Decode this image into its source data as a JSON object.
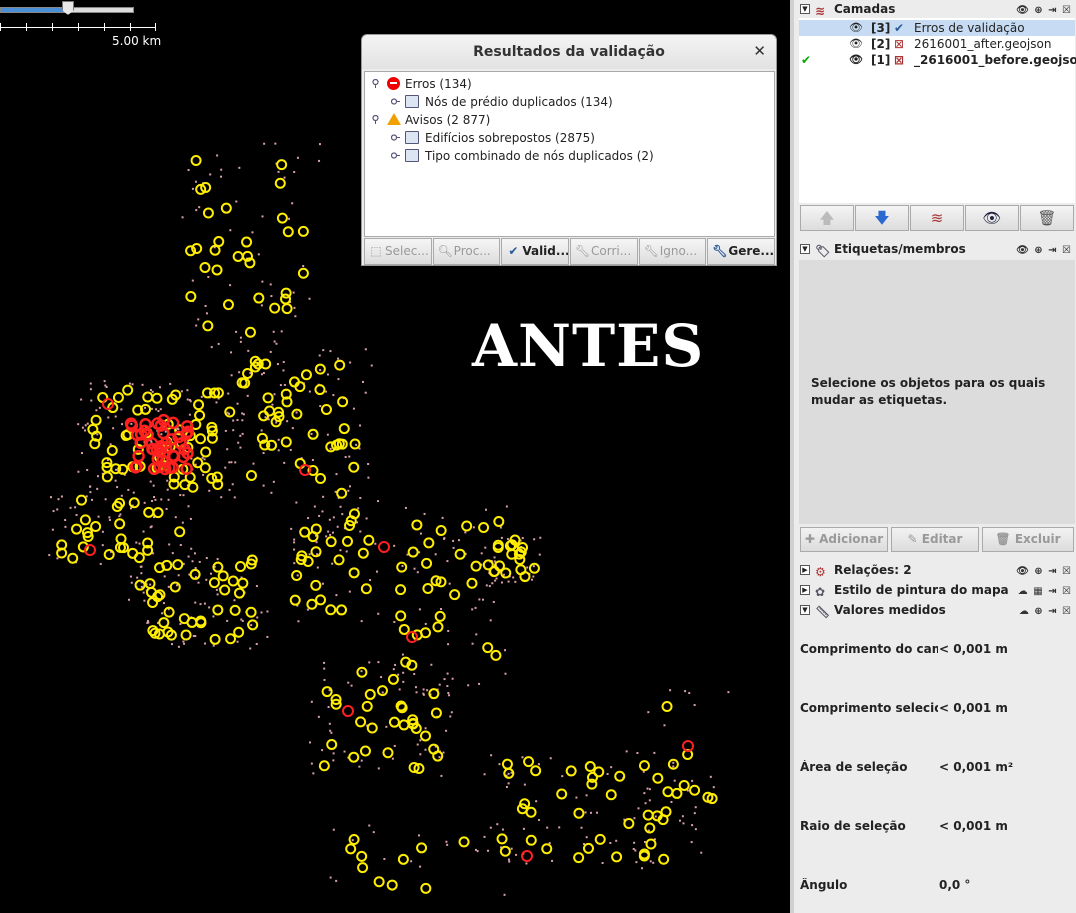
{
  "map": {
    "overlay_text": "ANTES",
    "scale_label": "5.00 km",
    "colors": {
      "background": "#000000",
      "warning_marker": "#ffee00",
      "error_marker": "#ff2020",
      "node": "#d8a0a8"
    }
  },
  "validation_dialog": {
    "title": "Resultados da validação",
    "close_icon": "close-icon",
    "tree": [
      {
        "label": "Erros (134)",
        "icon": "error-icon",
        "level": 0
      },
      {
        "label": "Nós de prédio duplicados (134)",
        "icon": "folder-icon",
        "level": 1
      },
      {
        "label": "Avisos (2 877)",
        "icon": "warning-icon",
        "level": 0
      },
      {
        "label": "Edifícios sobrepostos (2875)",
        "icon": "folder-icon",
        "level": 1
      },
      {
        "label": "Tipo combinado de nós duplicados (2)",
        "icon": "folder-icon",
        "level": 1
      }
    ],
    "buttons": [
      "Selec...",
      "Proc...",
      "Valid...",
      "Corri...",
      "Igno...",
      "Gere..."
    ]
  },
  "panel": {
    "layers": {
      "title": "Camadas",
      "items": [
        {
          "index": "[3]",
          "name": "Erros de validação",
          "selected": true
        },
        {
          "index": "[2]",
          "name": "2616001_after.geojson",
          "selected": false
        },
        {
          "index": "[1]",
          "name": "_2616001_before.geojson",
          "selected": false,
          "active": true
        }
      ]
    },
    "tags": {
      "title": "Etiquetas/membros",
      "message": "Selecione os objetos para os quais mudar as etiquetas.",
      "buttons": {
        "add": "Adicionar",
        "edit": "Editar",
        "delete": "Excluir"
      }
    },
    "relations_title": "Relações: 2",
    "map_style_title": "Estilo de pintura do mapa",
    "measurements": {
      "title": "Valores medidos",
      "rows": [
        {
          "label": "Comprimento do cam...",
          "value": "< 0,001 m"
        },
        {
          "label": "Comprimento selecio...",
          "value": "< 0,001 m"
        },
        {
          "label": "Área de seleção",
          "value": "< 0,001 m²"
        },
        {
          "label": "Raio de seleção",
          "value": "< 0,001 m"
        },
        {
          "label": "Ângulo",
          "value": "0,0 °"
        }
      ]
    }
  }
}
